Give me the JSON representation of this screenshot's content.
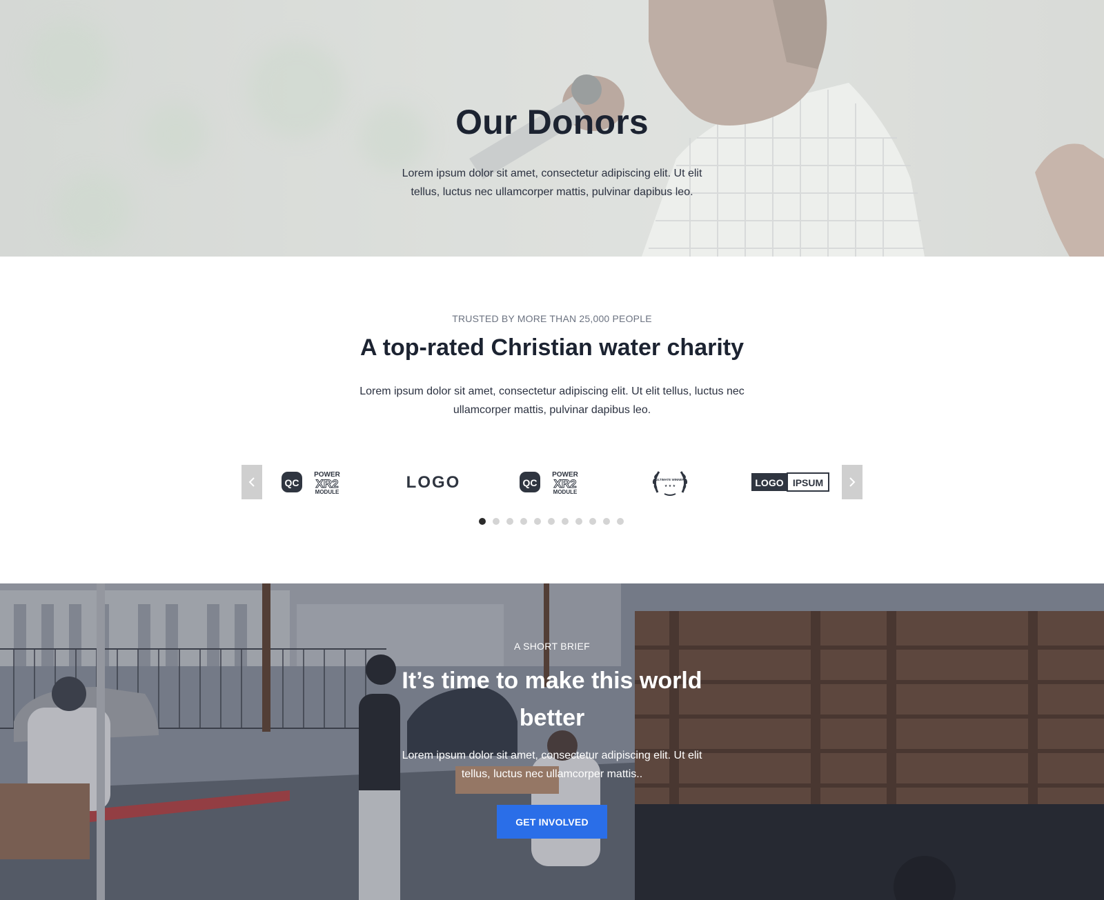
{
  "hero": {
    "title": "Our Donors",
    "text": "Lorem ipsum dolor sit amet, consectetur adipiscing elit. Ut elit tellus, luctus nec ullamcorper mattis, pulvinar dapibus leo."
  },
  "trust": {
    "eyebrow": "TRUSTED BY MORE THAN 25,000 PEOPLE",
    "title": "A top-rated Christian water charity",
    "text": "Lorem ipsum dolor sit amet, consectetur adipiscing elit. Ut elit tellus, luctus nec ullamcorper mattis, pulvinar dapibus leo.",
    "carousel": {
      "prev_icon": "chevron-left-icon",
      "next_icon": "chevron-right-icon",
      "logos": [
        {
          "name": "qc-power-xr2-module-logo",
          "badge": "QC",
          "lines": [
            "POWER",
            "XR2",
            "MODULE"
          ]
        },
        {
          "name": "logo-wordmark",
          "text": "LOGO"
        },
        {
          "name": "qc-power-xr2-module-logo",
          "badge": "QC",
          "lines": [
            "POWER",
            "XR2",
            "MODULE"
          ]
        },
        {
          "name": "laurel-award-logo",
          "text": "ULTIMATE WINNER"
        },
        {
          "name": "logo-ipsum-wordmark",
          "parts": [
            "LOGO",
            "IPSUM"
          ]
        }
      ],
      "dot_count": 11,
      "active_dot": 0
    }
  },
  "cta": {
    "eyebrow": "A SHORT BRIEF",
    "title": "It’s time to make this world better",
    "text": "Lorem ipsum dolor sit amet, consectetur adipiscing elit. Ut elit tellus, luctus nec ullamcorper mattis..",
    "button_label": "GET INVOLVED"
  },
  "colors": {
    "heading": "#1c2331",
    "accent_button": "#2a6ee8",
    "arrow_bg": "#cfcfcf",
    "dot_active": "#2b2b2b",
    "dot_inactive": "#d4d4d4"
  }
}
